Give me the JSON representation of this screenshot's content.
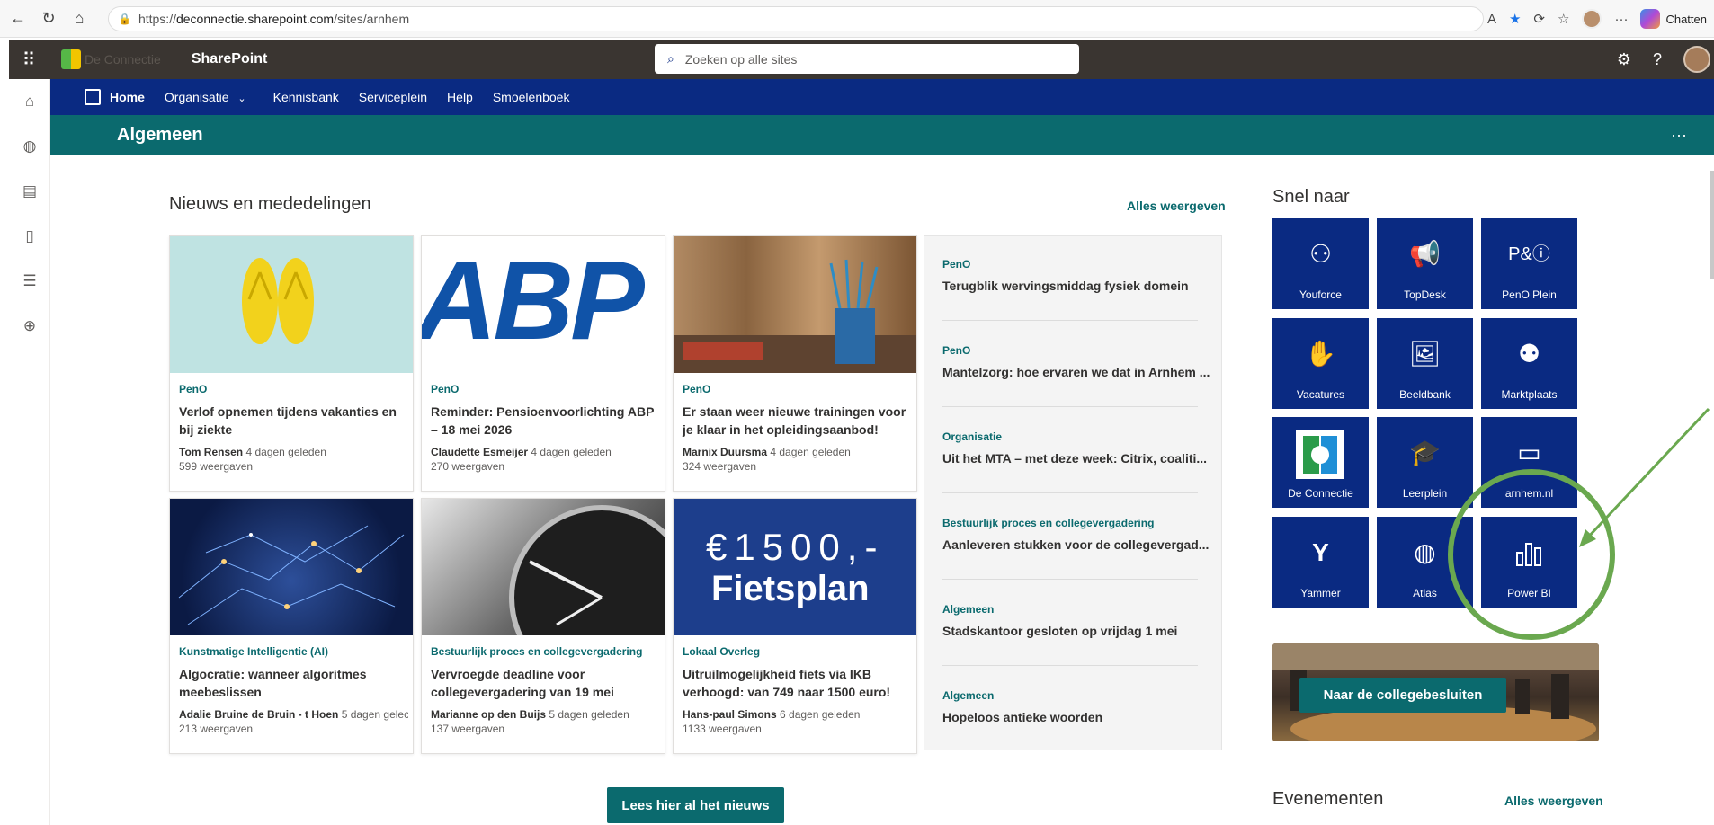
{
  "browser": {
    "url_prefix": "https://",
    "url_host": "deconnectie.sharepoint.com",
    "url_path": "/sites/arnhem",
    "chat_label": "Chatten"
  },
  "suite": {
    "logo_text": "De Connectie",
    "app_name": "SharePoint",
    "search_placeholder": "Zoeken op alle sites"
  },
  "hubnav": {
    "items": [
      "Home",
      "Organisatie",
      "Kennisbank",
      "Serviceplein",
      "Help",
      "Smoelenboek"
    ]
  },
  "site": {
    "title": "Algemeen"
  },
  "news": {
    "heading": "Nieuws en mededelingen",
    "see_all": "Alles weergeven",
    "cards": [
      {
        "category": "PenO",
        "title": "Verlof opnemen tijdens vakanties en bij ziekte",
        "author": "Tom Rensen",
        "time": "4 dagen geleden",
        "views": "599 weergaven"
      },
      {
        "category": "PenO",
        "title": "Reminder: Pensioenvoorlichting ABP – 18 mei 2026",
        "author": "Claudette Esmeijer",
        "time": "4 dagen geleden",
        "views": "270 weergaven",
        "image_text": "ABP"
      },
      {
        "category": "PenO",
        "title": "Er staan weer nieuwe trainingen voor je klaar in het opleidingsaanbod!",
        "author": "Marnix Duursma",
        "time": "4 dagen geleden",
        "views": "324 weergaven"
      },
      {
        "category": "Kunstmatige Intelligentie (AI)",
        "title": "Algocratie: wanneer algoritmes meebeslissen",
        "author": "Adalie Bruine de Bruin - t Hoen",
        "time": "5 dagen gelec",
        "views": "213 weergaven"
      },
      {
        "category": "Bestuurlijk proces en collegevergadering",
        "title": "Vervroegde deadline voor collegevergadering van 19 mei",
        "author": "Marianne op den Buijs",
        "time": "5 dagen geleden",
        "views": "137 weergaven"
      },
      {
        "category": "Lokaal Overleg",
        "title": "Uitruilmogelijkheid fiets via IKB verhoogd: van 749 naar 1500 euro!",
        "author": "Hans-paul Simons",
        "time": "6 dagen geleden",
        "views": "1133 weergaven",
        "image_text_1": "€1500,-",
        "image_text_2": "Fietsplan"
      }
    ],
    "list": [
      {
        "category": "PenO",
        "title": "Terugblik wervingsmiddag fysiek domein"
      },
      {
        "category": "PenO",
        "title": "Mantelzorg: hoe ervaren we dat in Arnhem ..."
      },
      {
        "category": "Organisatie",
        "title": "Uit het MTA – met deze week: Citrix, coaliti..."
      },
      {
        "category": "Bestuurlijk proces en collegevergadering",
        "title": "Aanleveren stukken voor de collegevergad..."
      },
      {
        "category": "Algemeen",
        "title": "Stadskantoor gesloten op vrijdag 1 mei"
      },
      {
        "category": "Algemeen",
        "title": "Hopeloos antieke woorden"
      }
    ],
    "read_all_button": "Lees hier al het nieuws"
  },
  "quicklinks": {
    "heading": "Snel naar",
    "tiles": [
      {
        "label": "Youforce",
        "icon": "person-briefcase-icon"
      },
      {
        "label": "TopDesk",
        "icon": "megaphone-icon"
      },
      {
        "label": "PenO Plein",
        "icon": "info-icon",
        "icon_text": "P&"
      },
      {
        "label": "Vacatures",
        "icon": "hand-wave-icon"
      },
      {
        "label": "Beeldbank",
        "icon": "image-icon"
      },
      {
        "label": "Marktplaats",
        "icon": "people-swap-icon"
      },
      {
        "label": "De Connectie",
        "icon": "de-connectie-logo"
      },
      {
        "label": "Leerplein",
        "icon": "person-graduation-icon"
      },
      {
        "label": "arnhem.nl",
        "icon": "browser-icon"
      },
      {
        "label": "Yammer",
        "icon": "yammer-icon"
      },
      {
        "label": "Atlas",
        "icon": "globe-icon"
      },
      {
        "label": "Power BI",
        "icon": "bar-chart-icon"
      }
    ],
    "highlight_color": "#6aa84f"
  },
  "banner": {
    "button": "Naar de collegebesluiten"
  },
  "events": {
    "heading": "Evenementen",
    "see_all": "Alles weergeven"
  },
  "colors": {
    "hub": "#0a2a82",
    "accent": "#0b6a6e",
    "suite": "#3a3531"
  }
}
